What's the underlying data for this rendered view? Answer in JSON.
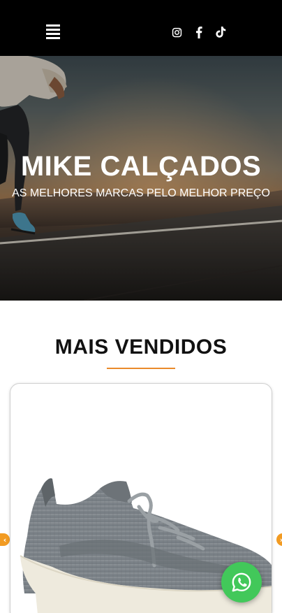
{
  "header": {
    "icons": [
      "menu-icon",
      "instagram-icon",
      "facebook-icon",
      "tiktok-icon"
    ]
  },
  "hero": {
    "title": "MIKE CALÇADOS",
    "subtitle": "AS MELHORES MARCAS PELO MELHOR PREÇO"
  },
  "section": {
    "title": "MAIS VENDIDOS",
    "accent_color": "#ea8a2b"
  },
  "carousel": {
    "prev_icon": "chevron-left-icon",
    "next_icon": "chevron-right-icon",
    "arrow_glyph_prev": "‹",
    "arrow_glyph_next": "›",
    "arrow_color": "#f29b22"
  },
  "product": {
    "image_icon": "sneaker-image",
    "shoe_color": "#8f9498",
    "sole_color": "#eeeadd"
  },
  "floating": {
    "icon": "whatsapp-icon",
    "color": "#42c85a"
  }
}
